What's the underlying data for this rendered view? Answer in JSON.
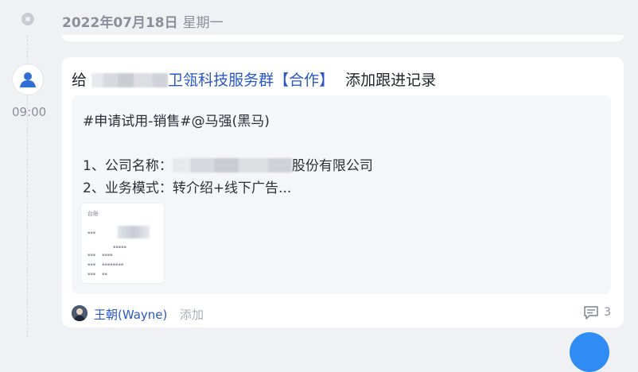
{
  "timeline": {
    "date": "2022年07月18日",
    "weekday": "星期一"
  },
  "entry": {
    "time": "09:00",
    "title_prefix": "给",
    "group_name": "卫瓴科技服务群【合作】",
    "action": "添加跟进记录",
    "content": {
      "line1": "#申请试用-销售#@马强(黑马)",
      "line2_label": "1、公司名称：",
      "line2_suffix": "股份有限公司",
      "line3": "2、业务模式：转介绍+线下广告..."
    },
    "thumbnail": {
      "title": "台账"
    },
    "author": "王朝(Wayne)",
    "add_label": "添加",
    "comment_count": "3"
  },
  "colors": {
    "link": "#2a57c9",
    "background": "#f0f1f5",
    "content_box": "#f4f6fa"
  },
  "icons": {
    "date_marker": "timeline-dot-icon",
    "avatar": "user-icon",
    "comment": "comment-icon"
  }
}
